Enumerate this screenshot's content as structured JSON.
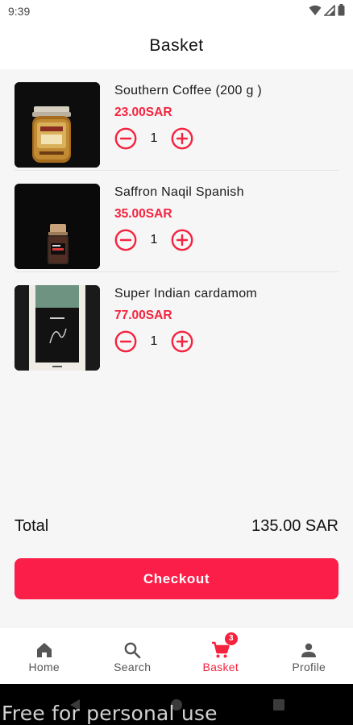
{
  "status_bar": {
    "time": "9:39"
  },
  "header": {
    "title": "Basket"
  },
  "cart": {
    "items": [
      {
        "name": "Southern Coffee (200 g )",
        "price": "23.00SAR",
        "quantity": "1"
      },
      {
        "name": "Saffron Naqil Spanish",
        "price": "35.00SAR",
        "quantity": "1"
      },
      {
        "name": "Super Indian cardamom",
        "price": "77.00SAR",
        "quantity": "1"
      }
    ]
  },
  "summary": {
    "total_label": "Total",
    "total_value": "135.00 SAR"
  },
  "checkout": {
    "label": "Checkout"
  },
  "bottom_nav": {
    "items": [
      {
        "label": "Home",
        "icon": "home-icon"
      },
      {
        "label": "Search",
        "icon": "search-icon"
      },
      {
        "label": "Basket",
        "icon": "cart-icon",
        "badge": "3",
        "active": true
      },
      {
        "label": "Profile",
        "icon": "person-icon"
      }
    ]
  },
  "watermark": {
    "text": "Free for personal use"
  },
  "colors": {
    "accent": "#f5233f",
    "checkout_bg": "#fb1e48",
    "background": "#f6f6f6"
  }
}
